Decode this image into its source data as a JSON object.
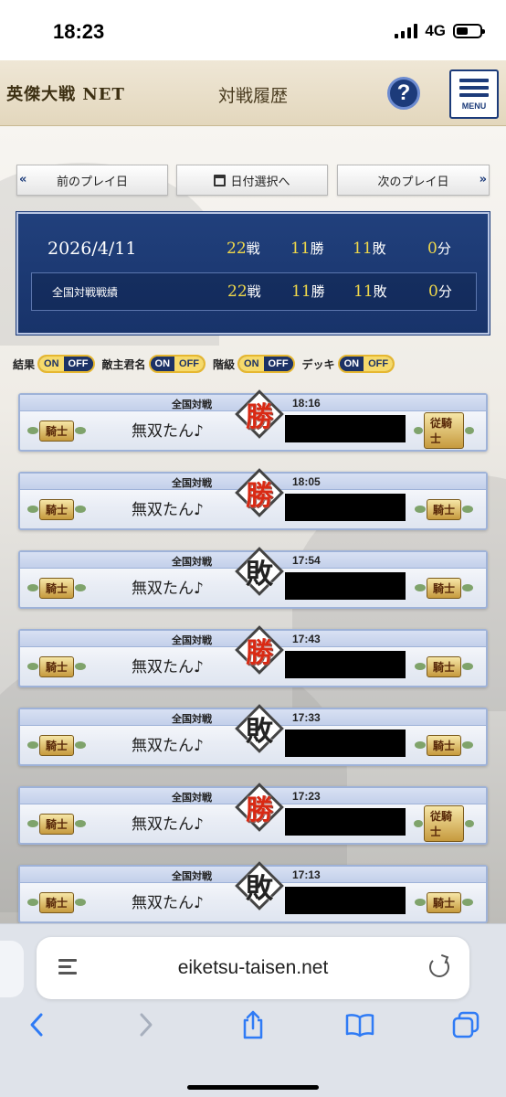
{
  "status_bar": {
    "time": "18:23",
    "network": "4G"
  },
  "header": {
    "logo_text": "英傑大戦 NET",
    "title": "対戦履歴",
    "help_label": "?",
    "menu_label": "MENU"
  },
  "nav": {
    "prev_label": "前のプレイ日",
    "date_label": "日付選択へ",
    "next_label": "次のプレイ日"
  },
  "summary": {
    "date": "2026/4/11",
    "row1": {
      "battles": "22",
      "battles_unit": "戦",
      "wins": "11",
      "wins_unit": "勝",
      "losses": "11",
      "losses_unit": "敗",
      "draws": "0",
      "draws_unit": "分"
    },
    "national_label": "全国対戦戦績",
    "row2": {
      "battles": "22",
      "battles_unit": "戦",
      "wins": "11",
      "wins_unit": "勝",
      "losses": "11",
      "losses_unit": "敗",
      "draws": "0",
      "draws_unit": "分"
    }
  },
  "toggles": [
    {
      "label": "結果",
      "on": "ON",
      "off": "OFF",
      "state": "on"
    },
    {
      "label": "敵主君名",
      "on": "ON",
      "off": "OFF",
      "state": "off"
    },
    {
      "label": "階級",
      "on": "ON",
      "off": "OFF",
      "state": "on"
    },
    {
      "label": "デッキ",
      "on": "ON",
      "off": "OFF",
      "state": "off"
    }
  ],
  "battles": [
    {
      "mode": "全国対戦",
      "time": "18:16",
      "player": "無双たん♪",
      "result": "勝",
      "outcome": "win",
      "my_rank": "騎士",
      "opp_rank": "従騎士"
    },
    {
      "mode": "全国対戦",
      "time": "18:05",
      "player": "無双たん♪",
      "result": "勝",
      "outcome": "win",
      "my_rank": "騎士",
      "opp_rank": "騎士"
    },
    {
      "mode": "全国対戦",
      "time": "17:54",
      "player": "無双たん♪",
      "result": "敗",
      "outcome": "lose",
      "my_rank": "騎士",
      "opp_rank": "騎士"
    },
    {
      "mode": "全国対戦",
      "time": "17:43",
      "player": "無双たん♪",
      "result": "勝",
      "outcome": "win",
      "my_rank": "騎士",
      "opp_rank": "騎士"
    },
    {
      "mode": "全国対戦",
      "time": "17:33",
      "player": "無双たん♪",
      "result": "敗",
      "outcome": "lose",
      "my_rank": "騎士",
      "opp_rank": "騎士"
    },
    {
      "mode": "全国対戦",
      "time": "17:23",
      "player": "無双たん♪",
      "result": "勝",
      "outcome": "win",
      "my_rank": "騎士",
      "opp_rank": "従騎士"
    },
    {
      "mode": "全国対戦",
      "time": "17:13",
      "player": "無双たん♪",
      "result": "敗",
      "outcome": "lose",
      "my_rank": "騎士",
      "opp_rank": "騎士"
    }
  ],
  "browser": {
    "url": "eiketsu-taisen.net"
  }
}
